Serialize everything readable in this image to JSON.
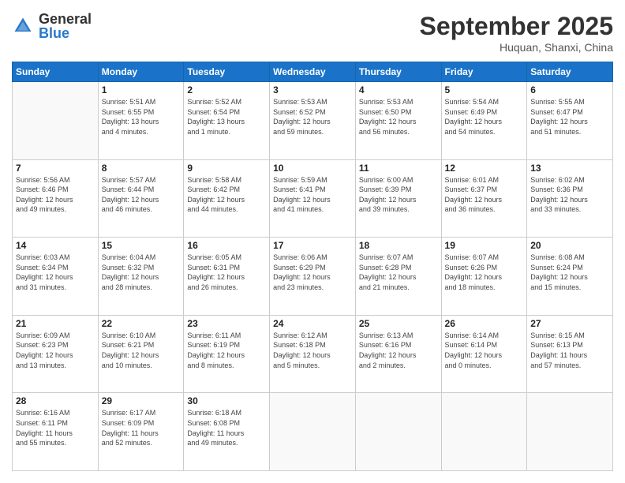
{
  "header": {
    "logo_general": "General",
    "logo_blue": "Blue",
    "month_title": "September 2025",
    "location": "Huquan, Shanxi, China"
  },
  "days_of_week": [
    "Sunday",
    "Monday",
    "Tuesday",
    "Wednesday",
    "Thursday",
    "Friday",
    "Saturday"
  ],
  "weeks": [
    [
      {
        "day": "",
        "info": ""
      },
      {
        "day": "1",
        "info": "Sunrise: 5:51 AM\nSunset: 6:55 PM\nDaylight: 13 hours\nand 4 minutes."
      },
      {
        "day": "2",
        "info": "Sunrise: 5:52 AM\nSunset: 6:54 PM\nDaylight: 13 hours\nand 1 minute."
      },
      {
        "day": "3",
        "info": "Sunrise: 5:53 AM\nSunset: 6:52 PM\nDaylight: 12 hours\nand 59 minutes."
      },
      {
        "day": "4",
        "info": "Sunrise: 5:53 AM\nSunset: 6:50 PM\nDaylight: 12 hours\nand 56 minutes."
      },
      {
        "day": "5",
        "info": "Sunrise: 5:54 AM\nSunset: 6:49 PM\nDaylight: 12 hours\nand 54 minutes."
      },
      {
        "day": "6",
        "info": "Sunrise: 5:55 AM\nSunset: 6:47 PM\nDaylight: 12 hours\nand 51 minutes."
      }
    ],
    [
      {
        "day": "7",
        "info": "Sunrise: 5:56 AM\nSunset: 6:46 PM\nDaylight: 12 hours\nand 49 minutes."
      },
      {
        "day": "8",
        "info": "Sunrise: 5:57 AM\nSunset: 6:44 PM\nDaylight: 12 hours\nand 46 minutes."
      },
      {
        "day": "9",
        "info": "Sunrise: 5:58 AM\nSunset: 6:42 PM\nDaylight: 12 hours\nand 44 minutes."
      },
      {
        "day": "10",
        "info": "Sunrise: 5:59 AM\nSunset: 6:41 PM\nDaylight: 12 hours\nand 41 minutes."
      },
      {
        "day": "11",
        "info": "Sunrise: 6:00 AM\nSunset: 6:39 PM\nDaylight: 12 hours\nand 39 minutes."
      },
      {
        "day": "12",
        "info": "Sunrise: 6:01 AM\nSunset: 6:37 PM\nDaylight: 12 hours\nand 36 minutes."
      },
      {
        "day": "13",
        "info": "Sunrise: 6:02 AM\nSunset: 6:36 PM\nDaylight: 12 hours\nand 33 minutes."
      }
    ],
    [
      {
        "day": "14",
        "info": "Sunrise: 6:03 AM\nSunset: 6:34 PM\nDaylight: 12 hours\nand 31 minutes."
      },
      {
        "day": "15",
        "info": "Sunrise: 6:04 AM\nSunset: 6:32 PM\nDaylight: 12 hours\nand 28 minutes."
      },
      {
        "day": "16",
        "info": "Sunrise: 6:05 AM\nSunset: 6:31 PM\nDaylight: 12 hours\nand 26 minutes."
      },
      {
        "day": "17",
        "info": "Sunrise: 6:06 AM\nSunset: 6:29 PM\nDaylight: 12 hours\nand 23 minutes."
      },
      {
        "day": "18",
        "info": "Sunrise: 6:07 AM\nSunset: 6:28 PM\nDaylight: 12 hours\nand 21 minutes."
      },
      {
        "day": "19",
        "info": "Sunrise: 6:07 AM\nSunset: 6:26 PM\nDaylight: 12 hours\nand 18 minutes."
      },
      {
        "day": "20",
        "info": "Sunrise: 6:08 AM\nSunset: 6:24 PM\nDaylight: 12 hours\nand 15 minutes."
      }
    ],
    [
      {
        "day": "21",
        "info": "Sunrise: 6:09 AM\nSunset: 6:23 PM\nDaylight: 12 hours\nand 13 minutes."
      },
      {
        "day": "22",
        "info": "Sunrise: 6:10 AM\nSunset: 6:21 PM\nDaylight: 12 hours\nand 10 minutes."
      },
      {
        "day": "23",
        "info": "Sunrise: 6:11 AM\nSunset: 6:19 PM\nDaylight: 12 hours\nand 8 minutes."
      },
      {
        "day": "24",
        "info": "Sunrise: 6:12 AM\nSunset: 6:18 PM\nDaylight: 12 hours\nand 5 minutes."
      },
      {
        "day": "25",
        "info": "Sunrise: 6:13 AM\nSunset: 6:16 PM\nDaylight: 12 hours\nand 2 minutes."
      },
      {
        "day": "26",
        "info": "Sunrise: 6:14 AM\nSunset: 6:14 PM\nDaylight: 12 hours\nand 0 minutes."
      },
      {
        "day": "27",
        "info": "Sunrise: 6:15 AM\nSunset: 6:13 PM\nDaylight: 11 hours\nand 57 minutes."
      }
    ],
    [
      {
        "day": "28",
        "info": "Sunrise: 6:16 AM\nSunset: 6:11 PM\nDaylight: 11 hours\nand 55 minutes."
      },
      {
        "day": "29",
        "info": "Sunrise: 6:17 AM\nSunset: 6:09 PM\nDaylight: 11 hours\nand 52 minutes."
      },
      {
        "day": "30",
        "info": "Sunrise: 6:18 AM\nSunset: 6:08 PM\nDaylight: 11 hours\nand 49 minutes."
      },
      {
        "day": "",
        "info": ""
      },
      {
        "day": "",
        "info": ""
      },
      {
        "day": "",
        "info": ""
      },
      {
        "day": "",
        "info": ""
      }
    ]
  ]
}
